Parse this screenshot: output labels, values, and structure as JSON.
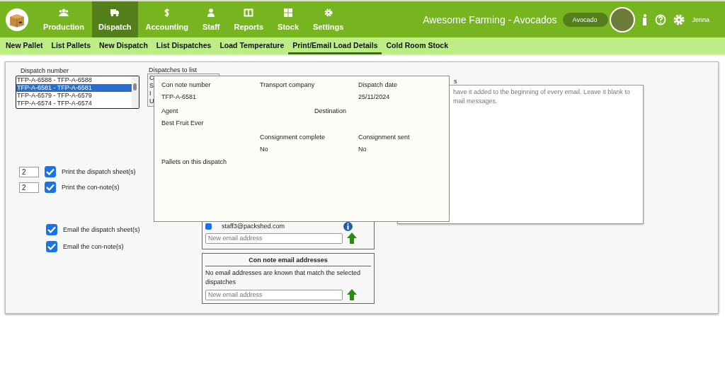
{
  "nav": {
    "tabs": [
      {
        "label": "Production",
        "selected": false
      },
      {
        "label": "Dispatch",
        "selected": true
      },
      {
        "label": "Accounting",
        "selected": false
      },
      {
        "label": "Staff",
        "selected": false
      },
      {
        "label": "Reports",
        "selected": false
      },
      {
        "label": "Stock",
        "selected": false
      },
      {
        "label": "Settings",
        "selected": false
      }
    ],
    "farm_title": "Awesome Farming - Avocados",
    "crop_badge": "Avocado",
    "user": "Jenna"
  },
  "subnav": [
    {
      "label": "New Pallet",
      "selected": false
    },
    {
      "label": "List Pallets",
      "selected": false
    },
    {
      "label": "New Dispatch",
      "selected": false
    },
    {
      "label": "List Dispatches",
      "selected": false
    },
    {
      "label": "Load Temperature",
      "selected": false
    },
    {
      "label": "Print/Email Load Details",
      "selected": true
    },
    {
      "label": "Cold Room Stock",
      "selected": false
    }
  ],
  "form": {
    "dispatch_label": "Dispatch number",
    "dispatches": [
      {
        "label": "TFP-A-6588 - TFP-A-6588",
        "selected": false
      },
      {
        "label": "TFP-A-6581 - TFP-A-6581",
        "selected": true
      },
      {
        "label": "TFP-A-6579 - TFP-A-6579",
        "selected": false
      },
      {
        "label": "TFP-A-6574 - TFP-A-6574",
        "selected": false
      }
    ],
    "list_label": "Dispatches to list",
    "list_options": [
      "C",
      "S",
      "I",
      "U"
    ],
    "message_label": "s",
    "message_placeholder_lines": [
      "have it added to the beginning of every email. Leave it blank to",
      "mail messages."
    ],
    "print_options": [
      {
        "copies": "2",
        "checked": true,
        "label": "Print the dispatch sheet(s)"
      },
      {
        "copies": "2",
        "checked": true,
        "label": "Print the con-note(s)"
      }
    ],
    "email_options": [
      {
        "checked": true,
        "label": "Email the dispatch sheet(s)"
      },
      {
        "checked": true,
        "label": "Email the con-note(s)"
      }
    ],
    "dispatch_emails": {
      "addresses": [
        {
          "email": "staff3@packshed.com",
          "checked": true
        }
      ],
      "placeholder": "New email address"
    },
    "connote_emails": {
      "title": "Con note email addresses",
      "message": "No email addresses are known that match the selected dispatches",
      "placeholder": "New email address"
    }
  },
  "popup": {
    "fields": [
      {
        "label": "Con note number",
        "value": "TFP-A-6581"
      },
      {
        "label": "Transport company"
      },
      {
        "label": "Dispatch date",
        "value": "25/11/2024"
      },
      {
        "label": "Agent",
        "value": "Best Fruit Ever"
      },
      {
        "label": "Destination"
      },
      {
        "label": "Consignment complete",
        "value": "No"
      },
      {
        "label": "Consignment sent",
        "value": "No"
      }
    ],
    "pallets_label": "Pallets on this dispatch"
  }
}
